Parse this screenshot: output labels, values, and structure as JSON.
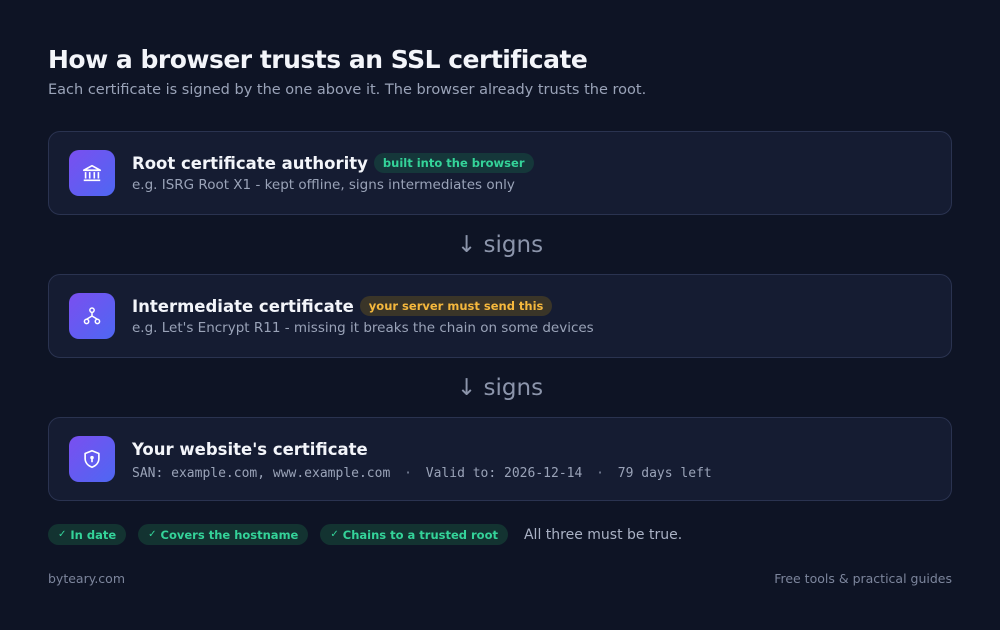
{
  "header": {
    "title": "How a browser trusts an SSL certificate",
    "subtitle": "Each certificate is signed by the one above it. The browser already trusts the root."
  },
  "chain": [
    {
      "icon": "bank-building-icon",
      "heading": "Root certificate authority",
      "badge": "built into the browser",
      "badge_color": "#34d399",
      "detail": "e.g. ISRG Root X1 - kept offline, signs intermediates only"
    },
    {
      "icon": "hierarchy-nodes-icon",
      "heading": "Intermediate certificate",
      "badge": "your server must send this",
      "badge_color": "#f5b83d",
      "detail": "e.g. Let's Encrypt R11 - missing it breaks the chain on some devices"
    },
    {
      "icon": "shield-lock-icon",
      "heading": "Your website's certificate",
      "san": "SAN: example.com, www.example.com",
      "valid_to": "Valid to: 2026-12-14",
      "days_left": "79 days left"
    }
  ],
  "connectors": [
    "↓ signs",
    "↓ signs"
  ],
  "separator": "·",
  "checks": {
    "items": [
      "In date",
      "Covers the hostname",
      "Chains to a trusted root"
    ],
    "check_glyph": "✓",
    "note": "All three must be true."
  },
  "footer": {
    "left": "byteary.com",
    "right": "Free tools & practical guides"
  },
  "colors": {
    "background": "#0e1425",
    "card": "#151c32",
    "accent_gradient_start": "#7a4ff0",
    "accent_gradient_end": "#4e67f2",
    "success": "#34d399",
    "warning": "#f5b83d"
  }
}
